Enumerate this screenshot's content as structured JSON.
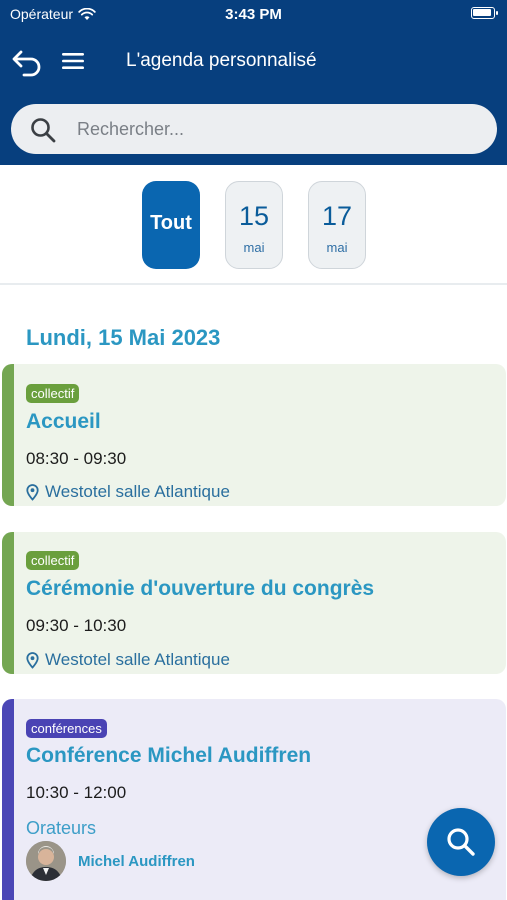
{
  "status_bar": {
    "carrier": "Opérateur",
    "time": "3:43 PM"
  },
  "nav": {
    "title": "L'agenda personnalisé"
  },
  "search": {
    "placeholder": "Rechercher..."
  },
  "date_filters": [
    {
      "label": "Tout",
      "active": true
    },
    {
      "label": "15",
      "sub": "mai",
      "active": false
    },
    {
      "label": "17",
      "sub": "mai",
      "active": false
    }
  ],
  "day_heading": "Lundi, 15 Mai 2023",
  "sessions": [
    {
      "tag": "collectif",
      "title": "Accueil",
      "time": "08:30 - 09:30",
      "location": "Westotel salle Atlantique",
      "color": "#74a652"
    },
    {
      "tag": "collectif",
      "title": "Cérémonie d'ouverture du congrès",
      "time": "09:30 - 10:30",
      "location": "Westotel salle Atlantique",
      "color": "#74a652"
    },
    {
      "tag": "conférences",
      "title": "Conférence Michel Audiffren",
      "time": "10:30 - 12:00",
      "speakers_label": "Orateurs",
      "speaker": "Michel Audiffren",
      "color": "#4b47b6"
    }
  ],
  "colors": {
    "header": "#073f7e",
    "accent": "#0a66b0",
    "title_blue": "#2b97c2"
  },
  "icons": {
    "back": "undo-arrow-icon",
    "menu": "hamburger-menu-icon",
    "search": "search-icon",
    "location": "location-pin-icon",
    "fab": "search-icon"
  }
}
